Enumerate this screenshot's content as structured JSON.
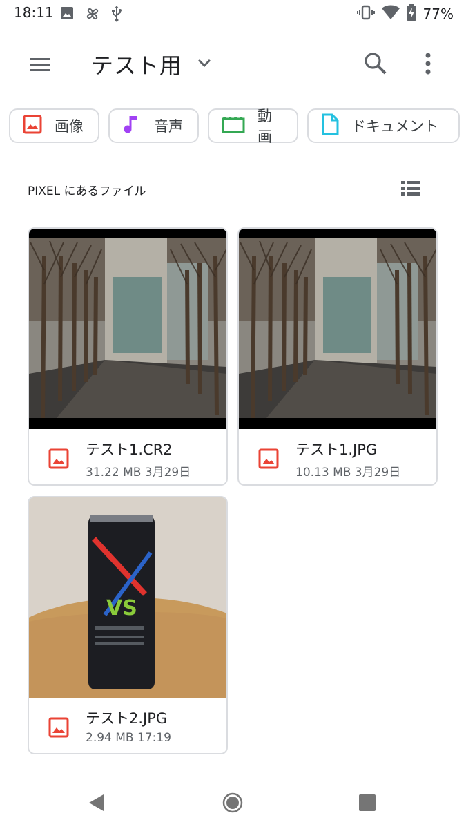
{
  "status_bar": {
    "time": "18:11",
    "battery_percent": "77%",
    "left_icons": [
      "image-icon",
      "pinwheel-icon",
      "usb-icon"
    ],
    "right_icons": [
      "vibrate-icon",
      "wifi-icon",
      "battery-charging-icon"
    ]
  },
  "app_bar": {
    "title": "テスト用",
    "icons": [
      "menu-icon",
      "chevron-down-icon",
      "search-icon",
      "more-vert-icon"
    ]
  },
  "filter_chips": [
    {
      "label": "画像",
      "icon": "image-icon",
      "color": "#ea4335"
    },
    {
      "label": "音声",
      "icon": "music-note-icon",
      "color": "#a142f4"
    },
    {
      "label": "動画",
      "icon": "movie-icon",
      "color": "#34a853"
    },
    {
      "label": "ドキュメント",
      "icon": "document-icon",
      "color": "#24c1e0"
    }
  ],
  "section": {
    "label": "PIXEL にあるファイル",
    "view_icon": "list-view-icon"
  },
  "files": [
    {
      "name": "テスト1.CR2",
      "meta": "31.22 MB 3月29日",
      "thumbnail": "street-trees-photo",
      "type_icon": "image-icon"
    },
    {
      "name": "テスト1.JPG",
      "meta": "10.13 MB 3月29日",
      "thumbnail": "street-trees-photo",
      "type_icon": "image-icon"
    },
    {
      "name": "テスト2.JPG",
      "meta": "2.94 MB 17:19",
      "thumbnail": "can-photo",
      "type_icon": "image-icon"
    }
  ],
  "colors": {
    "image_red": "#ea4335",
    "text_primary": "#202124",
    "text_secondary": "#5f6368",
    "outline": "#dadce0"
  }
}
